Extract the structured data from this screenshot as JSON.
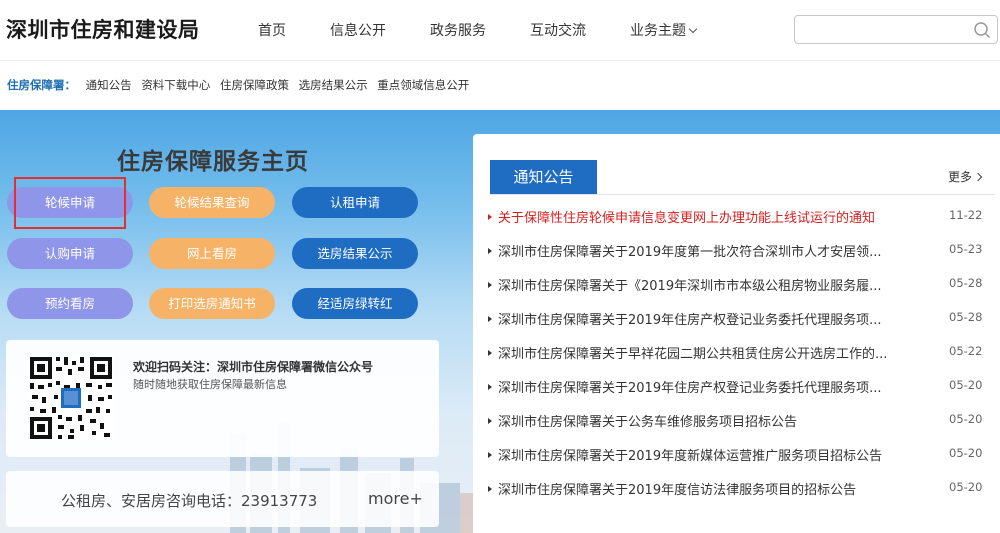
{
  "header": {
    "site_title": "深圳市住房和建设局",
    "nav": [
      "首页",
      "信息公开",
      "政务服务",
      "互动交流",
      "业务主题"
    ],
    "search_placeholder": ""
  },
  "breadcrumb": {
    "lead": "住房保障署：",
    "links": [
      "通知公告",
      "资料下载中心",
      "住房保障政策",
      "选房结果公示",
      "重点领域信息公开"
    ]
  },
  "main": {
    "title": "住房保障服务主页",
    "buttons": [
      {
        "label": "轮候申请"
      },
      {
        "label": "轮候结果查询"
      },
      {
        "label": "认租申请"
      },
      {
        "label": "认购申请"
      },
      {
        "label": "网上看房"
      },
      {
        "label": "选房结果公示"
      },
      {
        "label": "预约看房"
      },
      {
        "label": "打印选房通知书"
      },
      {
        "label": "经适房绿转红"
      }
    ]
  },
  "wechat": {
    "title": "欢迎扫码关注：深圳市住房保障署微信公众号",
    "subtitle": "随时随地获取住房保障最新信息"
  },
  "hotline": {
    "text": "公租房、安居房咨询电话：23913773",
    "more": "more+"
  },
  "notice": {
    "tab": "通知公告",
    "more": "更多",
    "items": [
      {
        "title": "关于保障性住房轮候申请信息变更网上办理功能上线试运行的通知",
        "date": "11-22",
        "highlight": true
      },
      {
        "title": "深圳市住房保障署关于2019年度第一批次符合深圳市人才安居领...",
        "date": "05-23"
      },
      {
        "title": "深圳市住房保障署关于《2019年深圳市市本级公租房物业服务履...",
        "date": "05-28"
      },
      {
        "title": "深圳市住房保障署关于2019年住房产权登记业务委托代理服务项...",
        "date": "05-28"
      },
      {
        "title": "深圳市住房保障署关于早祥花园二期公共租赁住房公开选房工作的...",
        "date": "05-22"
      },
      {
        "title": "深圳市住房保障署关于2019年住房产权登记业务委托代理服务项...",
        "date": "05-20"
      },
      {
        "title": "深圳市住房保障署关于公务车维修服务项目招标公告",
        "date": "05-20"
      },
      {
        "title": "深圳市住房保障署关于2019年度新媒体运营推广服务项目招标公告",
        "date": "05-20"
      },
      {
        "title": "深圳市住房保障署关于2019年度信访法律服务项目的招标公告",
        "date": "05-20"
      }
    ]
  }
}
